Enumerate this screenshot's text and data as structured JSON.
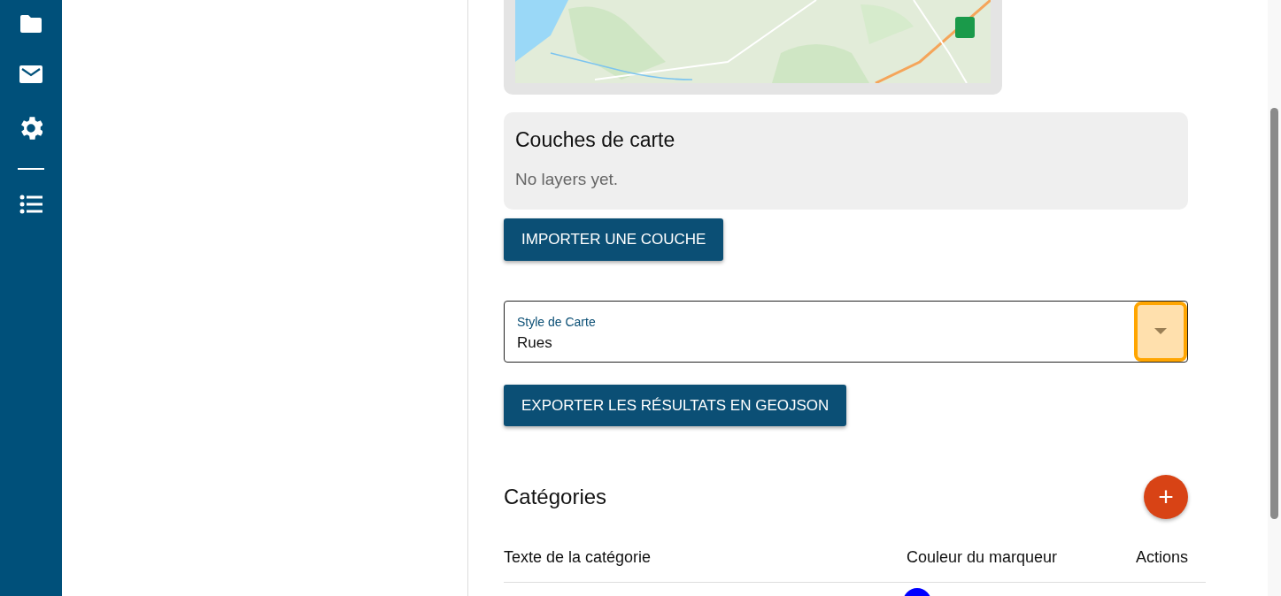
{
  "layers_panel": {
    "title": "Couches de carte",
    "empty_text": "No layers yet."
  },
  "import_button": "IMPORTER UNE COUCHE",
  "map_style_select": {
    "label": "Style de Carte",
    "value": "Rues",
    "arrow_focused": true
  },
  "export_button": "EXPORTER LES RÉSULTATS EN GEOJSON",
  "categories": {
    "title": "Catégories",
    "add_button": "+",
    "table": {
      "columns": [
        "Texte de la catégorie",
        "Couleur du marqueur",
        "Actions"
      ],
      "rows": [
        {
          "color": "#0000ff"
        }
      ]
    }
  }
}
